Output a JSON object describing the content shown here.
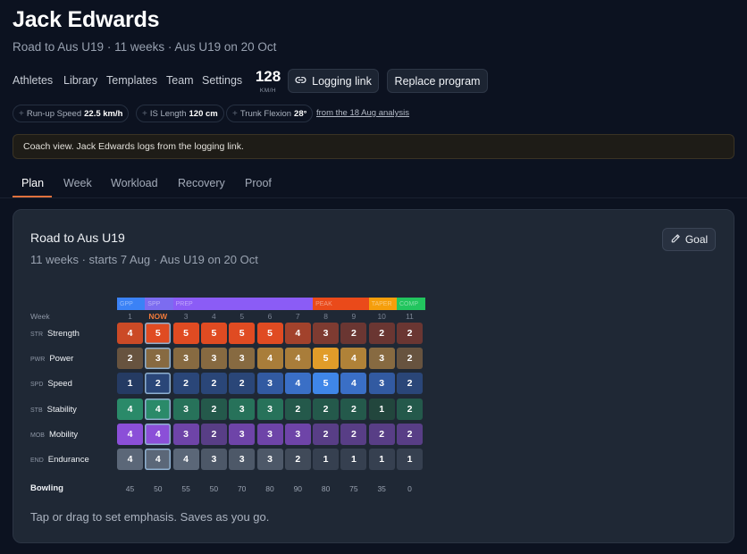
{
  "header": {
    "name": "Jack Edwards",
    "subtitle": "Road to Aus U19 · 11 weeks · Aus U19 on 20 Oct"
  },
  "nav": [
    "Athletes",
    "Library",
    "Templates",
    "Team",
    "Settings"
  ],
  "speed": {
    "value": "128",
    "unit": "KM/H"
  },
  "buttons": {
    "logging": "Logging link",
    "replace": "Replace program"
  },
  "metrics": [
    {
      "label": "Run-up Speed",
      "value": "22.5 km/h"
    },
    {
      "label": "IS Length",
      "value": "120 cm"
    },
    {
      "label": "Trunk Flexion",
      "value": "28°"
    }
  ],
  "analysis_link": "from the 18 Aug analysis",
  "notice": "Coach view. Jack Edwards logs from the logging link.",
  "tabs": [
    "Plan",
    "Week",
    "Workload",
    "Recovery",
    "Proof"
  ],
  "active_tab": "Plan",
  "plan": {
    "title": "Road to Aus U19",
    "subtitle": "11 weeks · starts 7 Aug · Aus U19 on 20 Oct",
    "goal_label": "Goal",
    "week_header": "Week",
    "weeks": [
      "1",
      "NOW",
      "3",
      "4",
      "5",
      "6",
      "7",
      "8",
      "9",
      "10",
      "11"
    ],
    "current_week_index": 1,
    "phases": [
      {
        "label": "GPP",
        "start": 0,
        "span": 1,
        "color": "#3b82f6"
      },
      {
        "label": "SPP",
        "start": 1,
        "span": 1,
        "color": "#7c6cf0"
      },
      {
        "label": "PREP",
        "start": 2,
        "span": 5,
        "color": "#8b5cf6"
      },
      {
        "label": "PEAK",
        "start": 7,
        "span": 2,
        "color": "#ea4a1a"
      },
      {
        "label": "TAPER",
        "start": 9,
        "span": 1,
        "color": "#f59e0b"
      },
      {
        "label": "COMP",
        "start": 10,
        "span": 1,
        "color": "#22c55e"
      }
    ],
    "rows": [
      {
        "abbr": "STR",
        "name": "Strength",
        "values": [
          4,
          5,
          5,
          5,
          5,
          5,
          4,
          3,
          2,
          2,
          2
        ],
        "colors": [
          "#cb4a26",
          "#e04b22",
          "#e04b22",
          "#e04b22",
          "#e04b22",
          "#e04b22",
          "#a2422c",
          "#7e3b31",
          "#6a3632",
          "#6a3632",
          "#6a3632"
        ]
      },
      {
        "abbr": "PWR",
        "name": "Power",
        "values": [
          2,
          3,
          3,
          3,
          3,
          4,
          4,
          5,
          4,
          3,
          2
        ],
        "colors": [
          "#67533f",
          "#876a41",
          "#876a41",
          "#876a41",
          "#876a41",
          "#a97d3a",
          "#a97d3a",
          "#e19c29",
          "#b08238",
          "#876a41",
          "#67533f"
        ]
      },
      {
        "abbr": "SPD",
        "name": "Speed",
        "values": [
          1,
          2,
          2,
          2,
          2,
          3,
          4,
          5,
          4,
          3,
          2
        ],
        "colors": [
          "#253b63",
          "#2a4678",
          "#2a4678",
          "#2a4678",
          "#2a4678",
          "#325aa1",
          "#3a6fc6",
          "#3f86e8",
          "#3a6fc6",
          "#325aa1",
          "#2a4678"
        ]
      },
      {
        "abbr": "STB",
        "name": "Stability",
        "values": [
          4,
          4,
          3,
          2,
          3,
          3,
          2,
          2,
          2,
          1,
          2
        ],
        "colors": [
          "#2a8a69",
          "#2a8a69",
          "#27725a",
          "#24594b",
          "#27725a",
          "#27725a",
          "#24594b",
          "#24594b",
          "#24594b",
          "#22463d",
          "#24594b"
        ]
      },
      {
        "abbr": "MOB",
        "name": "Mobility",
        "values": [
          4,
          4,
          3,
          2,
          3,
          3,
          3,
          2,
          2,
          2,
          2
        ],
        "colors": [
          "#8b4fd8",
          "#8b4fd8",
          "#6e44a8",
          "#583e86",
          "#6e44a8",
          "#6e44a8",
          "#6e44a8",
          "#583e86",
          "#583e86",
          "#583e86",
          "#583e86"
        ]
      },
      {
        "abbr": "END",
        "name": "Endurance",
        "values": [
          4,
          4,
          4,
          3,
          3,
          3,
          2,
          1,
          1,
          1,
          1
        ],
        "colors": [
          "#5b6778",
          "#5b6778",
          "#5b6778",
          "#4d5868",
          "#4d5868",
          "#4d5868",
          "#404a59",
          "#364050",
          "#364050",
          "#364050",
          "#364050"
        ]
      }
    ],
    "bowling_label": "Bowling",
    "bowling": [
      45,
      50,
      55,
      50,
      70,
      80,
      90,
      80,
      75,
      35,
      0
    ],
    "hint": "Tap or drag to set emphasis. Saves as you go."
  }
}
